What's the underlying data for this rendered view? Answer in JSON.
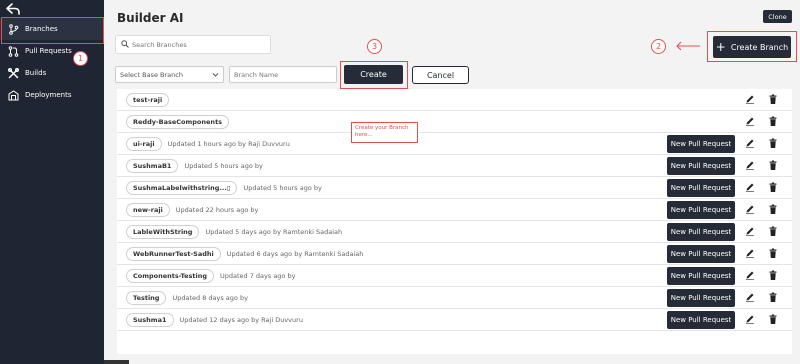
{
  "sidebar": {
    "back_icon": "arrow-back-icon",
    "items": [
      {
        "label": "Branches",
        "icon": "branch-icon"
      },
      {
        "label": "Pull Requests",
        "icon": "pull-request-icon"
      },
      {
        "label": "Builds",
        "icon": "tools-icon"
      },
      {
        "label": "Deployments",
        "icon": "deploy-icon"
      }
    ]
  },
  "header": {
    "title": "Builder AI",
    "clone_label": "Clone"
  },
  "search": {
    "placeholder": "Search Branches",
    "value": ""
  },
  "toolbar": {
    "create_branch_label": "Create Branch",
    "base_branch_placeholder": "Select Base Branch",
    "branch_name_placeholder": "Branch Name",
    "create_label": "Create",
    "cancel_label": "Cancel"
  },
  "annotations": {
    "step1": "1",
    "step2": "2",
    "step3": "3",
    "callout": "Create your Branch here..."
  },
  "branches": [
    {
      "name": "test-raji",
      "updated": "",
      "has_pr_button": false
    },
    {
      "name": "Reddy-BaseComponents",
      "updated": "",
      "has_pr_button": false
    },
    {
      "name": "ui-raji",
      "updated": "Updated  1 hours ago by Raji Duvvuru",
      "has_pr_button": true
    },
    {
      "name": "SushmaB1",
      "updated": "Updated  5 hours ago by",
      "has_pr_button": true
    },
    {
      "name": "SushmaLabelwithstring...▯",
      "updated": "Updated  5 hours ago by",
      "has_pr_button": true
    },
    {
      "name": "new-raji",
      "updated": "Updated  22 hours ago by",
      "has_pr_button": true
    },
    {
      "name": "LableWithString",
      "updated": "Updated 5 days ago by Ramtenki Sadaiah",
      "has_pr_button": true
    },
    {
      "name": "WebRunnerTest-Sadhi",
      "updated": "Updated 6 days ago by Ramtenki Sadaiah",
      "has_pr_button": true
    },
    {
      "name": "Components-Testing",
      "updated": "Updated 7 days ago by",
      "has_pr_button": true
    },
    {
      "name": "Testing",
      "updated": "Updated 8 days ago by",
      "has_pr_button": true
    },
    {
      "name": "Sushma1",
      "updated": "Updated 12 days ago by Raji Duvvuru",
      "has_pr_button": true
    }
  ],
  "new_pr_label": "New Pull Request",
  "colors": {
    "sidebar_bg": "#1f2532",
    "button_dark": "#252b37",
    "annotation_red": "#e05050",
    "page_bg": "#f3f3f3"
  }
}
